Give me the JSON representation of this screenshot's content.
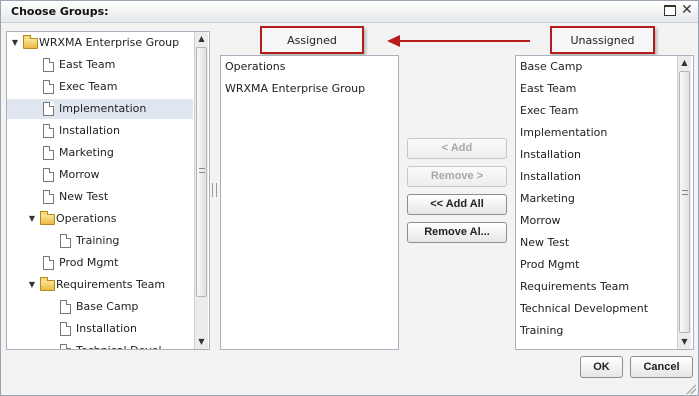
{
  "dialog": {
    "title": "Choose Groups:",
    "maximize_icon": "maximize-icon",
    "close_glyph": "✕"
  },
  "tree": {
    "items": [
      {
        "label": "WRXMA Enterprise Group",
        "icon": "folder-icon",
        "expanded": true
      },
      {
        "label": "East Team",
        "icon": "document-icon"
      },
      {
        "label": "Exec Team",
        "icon": "document-icon"
      },
      {
        "label": "Implementation",
        "icon": "document-icon",
        "selected": true
      },
      {
        "label": "Installation",
        "icon": "document-icon"
      },
      {
        "label": "Marketing",
        "icon": "document-icon"
      },
      {
        "label": "Morrow",
        "icon": "document-icon"
      },
      {
        "label": "New Test",
        "icon": "document-icon"
      },
      {
        "label": "Operations",
        "icon": "folder-icon",
        "expanded": true
      },
      {
        "label": "Training",
        "icon": "document-icon"
      },
      {
        "label": "Prod Mgmt",
        "icon": "document-icon"
      },
      {
        "label": "Requirements Team",
        "icon": "folder-icon",
        "expanded": true
      },
      {
        "label": "Base Camp",
        "icon": "document-icon"
      },
      {
        "label": "Installation",
        "icon": "document-icon"
      },
      {
        "label": "Technical Devel...",
        "icon": "document-icon"
      }
    ]
  },
  "assigned": {
    "header": "Assigned",
    "items": [
      "Operations",
      "WRXMA Enterprise Group"
    ]
  },
  "unassigned": {
    "header": "Unassigned",
    "items": [
      "Base Camp",
      "East Team",
      "Exec Team",
      "Implementation",
      "Installation",
      "Installation",
      "Marketing",
      "Morrow",
      "New Test",
      "Prod Mgmt",
      "Requirements Team",
      "Technical Development",
      "Training"
    ]
  },
  "buttons": {
    "add": "< Add",
    "remove": "Remove >",
    "add_all": "<< Add All",
    "remove_all": "Remove Al...",
    "ok": "OK",
    "cancel": "Cancel"
  },
  "colors": {
    "highlight_red": "#b71c1c",
    "selected_row": "#dfe6ef"
  }
}
